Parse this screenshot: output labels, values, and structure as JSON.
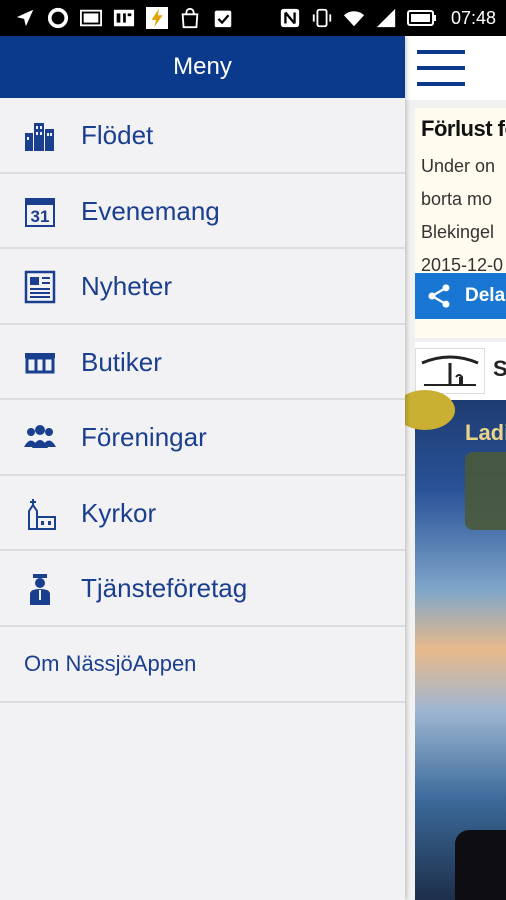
{
  "status_bar": {
    "time": "07:48",
    "icons_left": [
      "navigation-icon",
      "circle-icon",
      "image-icon",
      "af-icon",
      "flash-icon",
      "bag-icon",
      "clipboard-icon"
    ],
    "icons_right": [
      "nfc-icon",
      "vibrate-icon",
      "wifi-icon",
      "signal-icon",
      "battery-icon"
    ]
  },
  "drawer": {
    "title": "Meny",
    "items": [
      {
        "label": "Flödet",
        "icon": "buildings-icon"
      },
      {
        "label": "Evenemang",
        "icon": "calendar-icon"
      },
      {
        "label": "Nyheter",
        "icon": "newspaper-icon"
      },
      {
        "label": "Butiker",
        "icon": "shop-icon"
      },
      {
        "label": "Föreningar",
        "icon": "group-icon"
      },
      {
        "label": "Kyrkor",
        "icon": "church-icon"
      },
      {
        "label": "Tjänsteföretag",
        "icon": "service-person-icon"
      }
    ],
    "about_label": "Om NässjöAppen",
    "calendar_day": "31"
  },
  "main": {
    "card1": {
      "title": "Förlust fö",
      "lines": [
        "Under on",
        "borta mo",
        "Blekingel",
        "2015-12-0"
      ]
    },
    "share_label": "Dela",
    "card2_initial": "S",
    "photo_text": "Ladi"
  },
  "colors": {
    "header_blue": "#0b3a8c",
    "link_blue": "#1a3f8f",
    "share_blue": "#1976d2"
  }
}
